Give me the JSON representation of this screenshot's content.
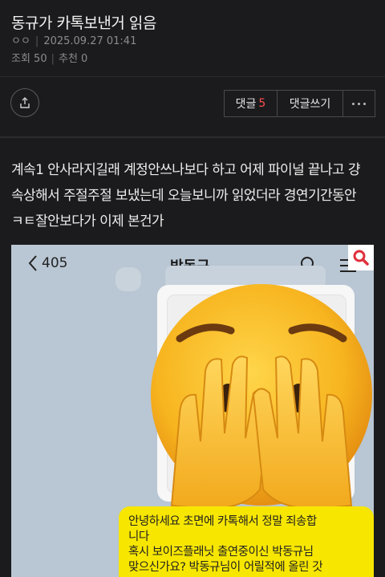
{
  "post": {
    "title": "동규가 카톡보낸거 읽음",
    "author": "ㅇㅇ",
    "datetime": "2025.09.27 01:41",
    "views": "조회 50",
    "recommend": "추천 0"
  },
  "actions": {
    "comment_label": "댓글",
    "comment_count": "5",
    "write_comment_label": "댓글쓰기"
  },
  "body": {
    "text": "계속1 안사라지길래 계정안쓰나보다 하고 어제 파이널 끝나고 걍 속상해서 주절주절 보냈는데 오늘보니까 읽었더라 경연기간동안 ㅋㅌ잘안보다가 이제 본건가"
  },
  "screenshot": {
    "back_count": "405",
    "chat_name": "박동규",
    "message_lines": [
      "안녕하세요 초면에 카톡해서 정말 죄송합",
      "니다",
      "혹시 보이즈플래닛 출연중이신 박동규님",
      "맞으신가요? 박동규님이 어릴적에 올린 갓"
    ],
    "overlay_emoji": "face-with-hands-covering-eyes",
    "colors": {
      "chat_bg": "#b9c6d3",
      "bubble": "#f7e600",
      "zoom_icon": "#e0303c"
    }
  },
  "theme": {
    "background": "#1b1b1d",
    "accent_count": "#ff4f4f"
  }
}
